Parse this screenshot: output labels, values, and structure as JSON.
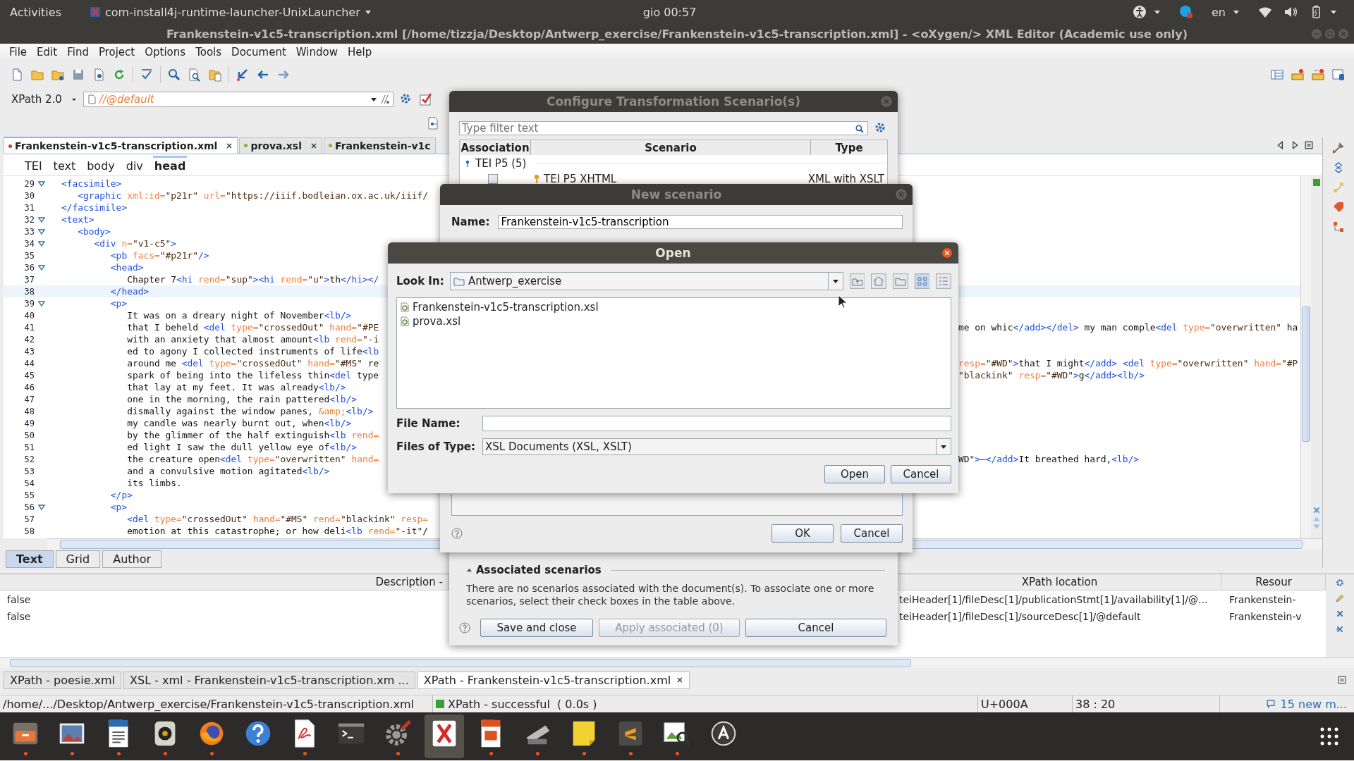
{
  "top_bar": {
    "activities": "Activities",
    "app": "com-install4j-runtime-launcher-UnixLauncher",
    "clock": "gio 00:57",
    "language": "en"
  },
  "window": {
    "title": "Frankenstein-v1c5-transcription.xml [/home/tizzja/Desktop/Antwerp_exercise/Frankenstein-v1c5-transcription.xml] - <oXygen/> XML Editor (Academic use only)"
  },
  "menu": [
    "File",
    "Edit",
    "Find",
    "Project",
    "Options",
    "Tools",
    "Document",
    "Window",
    "Help"
  ],
  "xpath": {
    "version": "XPath 2.0",
    "query": "//@default"
  },
  "editor_tabs": [
    {
      "label": "Frankenstein-v1c5-transcription.xml",
      "selected": true,
      "color": "#e0392b",
      "closable": true
    },
    {
      "label": "prova.xsl",
      "selected": false,
      "color": "#7cb82f",
      "closable": true
    },
    {
      "label": "Frankenstein-v1c",
      "selected": false,
      "color": "#7cb82f",
      "closable": false
    }
  ],
  "breadcrumb": [
    {
      "label": "TEI",
      "selected": false
    },
    {
      "label": "text",
      "selected": false
    },
    {
      "label": "body",
      "selected": false
    },
    {
      "label": "div",
      "selected": false
    },
    {
      "label": "head",
      "selected": true
    }
  ],
  "code": [
    {
      "number": "29",
      "fold": true,
      "current": false,
      "text": "<facsimile>"
    },
    {
      "number": "30",
      "fold": false,
      "current": false,
      "text": "   <graphic xml:id=\"p21r\" url=\"https://iiif.bodleian.ox.ac.uk/iiif/"
    },
    {
      "number": "31",
      "fold": false,
      "current": false,
      "text": "</facsimile>"
    },
    {
      "number": "32",
      "fold": true,
      "current": false,
      "text": "<text>"
    },
    {
      "number": "33",
      "fold": true,
      "current": false,
      "text": "   <body>"
    },
    {
      "number": "34",
      "fold": true,
      "current": false,
      "text": "      <div n=\"v1-c5\">"
    },
    {
      "number": "35",
      "fold": false,
      "current": false,
      "text": "         <pb facs=\"#p21r\"/>"
    },
    {
      "number": "36",
      "fold": true,
      "current": false,
      "text": "         <head>"
    },
    {
      "number": "37",
      "fold": false,
      "current": false,
      "text": "            Chapter 7<hi rend=\"sup\"><hi rend=\"u\">th</hi></"
    },
    {
      "number": "38",
      "fold": false,
      "current": true,
      "text": "         </head>"
    },
    {
      "number": "39",
      "fold": true,
      "current": false,
      "text": "         <p>"
    },
    {
      "number": "40",
      "fold": false,
      "current": false,
      "text": "            It was on a dreary night of November<lb/>"
    },
    {
      "number": "41",
      "fold": false,
      "current": false,
      "text": "            that I beheld <del type=\"crossedOut\" hand=\"#PE",
      "tail": "me on whic</add></del> my man comple<del type=\"overwritten\" ha"
    },
    {
      "number": "42",
      "fold": false,
      "current": false,
      "text": "            with an anxiety that almost amount<lb rend=\"-i"
    },
    {
      "number": "43",
      "fold": false,
      "current": false,
      "text": "            ed to agony I collected instruments of life<lb"
    },
    {
      "number": "44",
      "fold": false,
      "current": false,
      "text": "            around me <del type=\"crossedOut\" hand=\"#MS\" re",
      "tail": "resp=\"#WD\">that I might</add> <del type=\"overwritten\" hand=\"#P"
    },
    {
      "number": "45",
      "fold": false,
      "current": false,
      "text": "            spark of being into the lifeless thin<del type",
      "tail": "\"blackink\" resp=\"#WD\">g</add><lb/>"
    },
    {
      "number": "46",
      "fold": false,
      "current": false,
      "text": "            that lay at my feet. It was already<lb/>"
    },
    {
      "number": "47",
      "fold": false,
      "current": false,
      "text": "            one in the morning, the rain pattered<lb/>"
    },
    {
      "number": "48",
      "fold": false,
      "current": false,
      "text": "            dismally against the window panes, &amp;<lb/>"
    },
    {
      "number": "49",
      "fold": false,
      "current": false,
      "text": "            my candle was nearly burnt out, when<lb/>"
    },
    {
      "number": "50",
      "fold": false,
      "current": false,
      "text": "            by the glimmer of the half extinguish<lb rend="
    },
    {
      "number": "51",
      "fold": false,
      "current": false,
      "text": "            ed light I saw the dull yellow eye of<lb/>"
    },
    {
      "number": "52",
      "fold": false,
      "current": false,
      "text": "            the creature open<del type=\"overwritten\" hand=",
      "tail": "WD\">—</add>It breathed hard,<lb/>"
    },
    {
      "number": "53",
      "fold": false,
      "current": false,
      "text": "            and a convulsive motion agitated<lb/>"
    },
    {
      "number": "54",
      "fold": false,
      "current": false,
      "text": "            its limbs."
    },
    {
      "number": "55",
      "fold": false,
      "current": false,
      "text": "         </p>"
    },
    {
      "number": "56",
      "fold": true,
      "current": false,
      "text": "         <p>"
    },
    {
      "number": "57",
      "fold": false,
      "current": false,
      "text": "            <del type=\"crossedOut\" hand=\"#MS\" rend=\"blackink\" resp="
    },
    {
      "number": "58",
      "fold": false,
      "current": false,
      "text": "            emotion at this catastrophe; or how deli<lb rend=\"-it\"/"
    }
  ],
  "mode_tabs": [
    {
      "label": "Text",
      "selected": true
    },
    {
      "label": "Grid",
      "selected": false
    },
    {
      "label": "Author",
      "selected": false
    }
  ],
  "results": {
    "columns": [
      "Description -",
      "XPath location",
      "Resour"
    ],
    "rows": [
      {
        "description": "false",
        "xpath": "teiHeader[1]/fileDesc[1]/publicationStmt[1]/availability[1]/@...",
        "resource": "Frankenstein-"
      },
      {
        "description": "false",
        "xpath": "teiHeader[1]/fileDesc[1]/sourceDesc[1]/@default",
        "resource": "Frankenstein-v"
      }
    ]
  },
  "output_tabs": [
    {
      "label": "XPath - poesie.xml",
      "selected": false
    },
    {
      "label": "XSL - xml - Frankenstein-v1c5-transcription.xm ...",
      "selected": false
    },
    {
      "label": "XPath - Frankenstein-v1c5-transcription.xml",
      "selected": true
    }
  ],
  "status_bar": {
    "path": "/home/.../Desktop/Antwerp_exercise/Frankenstein-v1c5-transcription.xml",
    "message": "XPath - successful  ( 0.0s )",
    "encoding": "U+000A",
    "position": "38 : 20",
    "notifications": "15 new m..."
  },
  "configure_dialog": {
    "title": "Configure Transformation Scenario(s)",
    "filter_placeholder": "Type filter text",
    "columns": [
      "Association",
      "Scenario",
      "Type"
    ],
    "group": "TEI P5 (5)",
    "rows": [
      {
        "checked": false,
        "scenario": "TEI P5 XHTML",
        "type": "XML with XSLT"
      }
    ],
    "section": {
      "title": "Associated scenarios",
      "expanded": true,
      "text": "There are no scenarios associated with the document(s). To associate one or more scenarios, select their check boxes in the table above."
    },
    "buttons": [
      {
        "label": "Save and close",
        "disabled": false
      },
      {
        "label": "Apply associated (0)",
        "disabled": true
      },
      {
        "label": "Cancel",
        "disabled": false
      }
    ]
  },
  "new_scenario_dialog": {
    "title": "New scenario",
    "name_label": "Name:",
    "name": "Frankenstein-v1c5-transcription",
    "buttons": [
      "OK",
      "Cancel"
    ]
  },
  "open_dialog": {
    "title": "Open",
    "look_in_label": "Look In:",
    "folder": "Antwerp_exercise",
    "view_buttons": [
      {
        "selected": true
      },
      {
        "selected": false
      }
    ],
    "files": [
      {
        "name": "Frankenstein-v1c5-transcription.xsl",
        "selected": false
      },
      {
        "name": "prova.xsl",
        "selected": false
      }
    ],
    "file_name_label": "File Name:",
    "type_label": "Files of Type:",
    "file_type": "XSL Documents (XSL, XSLT)",
    "buttons": [
      "Open",
      "Cancel"
    ]
  },
  "dock": [
    {
      "running": true,
      "selected": false
    },
    {
      "running": true,
      "selected": false
    },
    {
      "running": true,
      "selected": false
    },
    {
      "running": true,
      "selected": false
    },
    {
      "running": true,
      "selected": false
    },
    {
      "running": false,
      "selected": false
    },
    {
      "running": true,
      "selected": false
    },
    {
      "running": false,
      "selected": false
    },
    {
      "running": true,
      "selected": false
    },
    {
      "running": false,
      "selected": true
    },
    {
      "running": true,
      "selected": false
    },
    {
      "running": true,
      "selected": false
    },
    {
      "running": true,
      "selected": false
    },
    {
      "running": true,
      "selected": false
    },
    {
      "running": true,
      "selected": false
    },
    {
      "running": false,
      "selected": false
    }
  ]
}
